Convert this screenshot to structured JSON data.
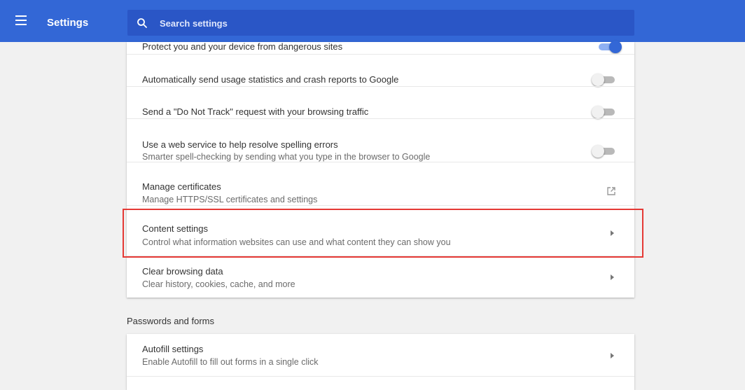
{
  "header": {
    "title": "Settings",
    "menu_icon": "hamburger-menu-icon",
    "search": {
      "placeholder": "Search settings",
      "value": "",
      "icon": "search-icon"
    },
    "bg_color": "#3367d6",
    "search_bg_color": "#2a56c6"
  },
  "privacy_section": {
    "rows": [
      {
        "label": "Protect you and your device from dangerous sites",
        "control": "toggle",
        "state": "on"
      },
      {
        "label": "Automatically send usage statistics and crash reports to Google",
        "control": "toggle",
        "state": "off"
      },
      {
        "label": "Send a \"Do Not Track\" request with your browsing traffic",
        "control": "toggle",
        "state": "off"
      },
      {
        "label": "Use a web service to help resolve spelling errors",
        "sublabel": "Smarter spell-checking by sending what you type in the browser to Google",
        "control": "toggle",
        "state": "off"
      },
      {
        "label": "Manage certificates",
        "sublabel": "Manage HTTPS/SSL certificates and settings",
        "control": "external-link-icon"
      },
      {
        "label": "Content settings",
        "sublabel": "Control what information websites can use and what content they can show you",
        "control": "arrow-right-icon",
        "highlighted": true
      },
      {
        "label": "Clear browsing data",
        "sublabel": "Clear history, cookies, cache, and more",
        "control": "arrow-right-icon"
      }
    ]
  },
  "passwords_section": {
    "title": "Passwords and forms",
    "rows": [
      {
        "label": "Autofill settings",
        "sublabel": "Enable Autofill to fill out forms in a single click",
        "control": "arrow-right-icon"
      }
    ]
  },
  "colors": {
    "accent": "#3367d6",
    "highlight_border": "#e53935",
    "page_bg": "#f1f1f1"
  }
}
